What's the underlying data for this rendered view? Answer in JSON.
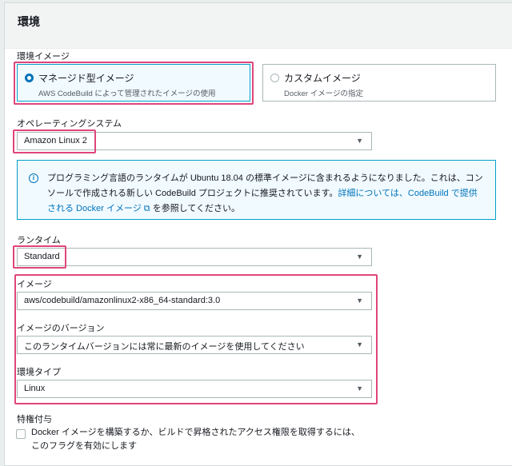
{
  "section": {
    "title": "環境"
  },
  "env_image": {
    "label": "環境イメージ",
    "options": [
      {
        "title": "マネージド型イメージ",
        "desc": "AWS CodeBuild によって管理されたイメージの使用",
        "selected": true
      },
      {
        "title": "カスタムイメージ",
        "desc": "Docker イメージの指定",
        "selected": false
      }
    ]
  },
  "os": {
    "label": "オペレーティングシステム",
    "value": "Amazon Linux 2"
  },
  "info": {
    "text": "プログラミング言語のランタイムが Ubuntu 18.04 の標準イメージに含まれるようになりました。これは、コンソールで作成される新しい CodeBuild プロジェクトに推奨されています。",
    "link": "詳細については、CodeBuild で提供される Docker イメージ",
    "suffix": " を参照してください。"
  },
  "runtime": {
    "label": "ランタイム",
    "value": "Standard"
  },
  "image": {
    "label": "イメージ",
    "value": "aws/codebuild/amazonlinux2-x86_64-standard:3.0"
  },
  "image_version": {
    "label": "イメージのバージョン",
    "value": "このランタイムバージョンには常に最新のイメージを使用してください"
  },
  "env_type": {
    "label": "環境タイプ",
    "value": "Linux"
  },
  "privileged": {
    "label": "特権付与",
    "checkbox_text": "Docker イメージを構築するか、ビルドで昇格されたアクセス権限を取得するには、このフラグを有効にします",
    "checked": false
  }
}
